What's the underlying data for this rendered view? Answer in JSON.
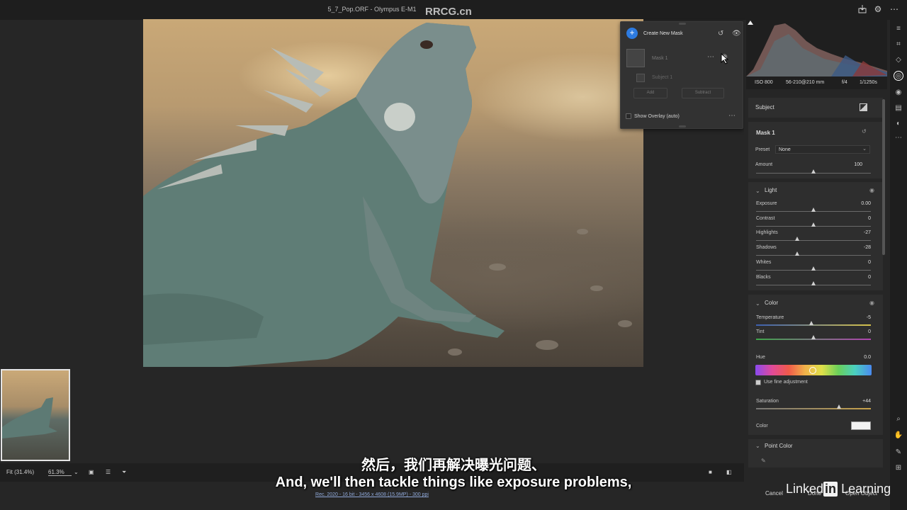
{
  "window": {
    "title": "5_7_Pop.ORF  -  Olympus E-M1"
  },
  "watermark_top": "RRCG.cn",
  "mask_panel": {
    "create_label": "Create New Mask",
    "mask_name": "Mask 1",
    "subject_name": "Subject 1",
    "add_label": "Add",
    "subtract_label": "Subtract",
    "overlay_label": "Show Overlay (auto)"
  },
  "exif": {
    "iso": "ISO 800",
    "lens": "56-210@210 mm",
    "aperture": "f/4",
    "shutter": "1/1250s"
  },
  "subject_header": "Subject",
  "mask": {
    "title": "Mask 1",
    "preset_label": "Preset",
    "preset_value": "None",
    "amount_label": "Amount",
    "amount_value": "100"
  },
  "light": {
    "title": "Light",
    "sliders": [
      {
        "label": "Exposure",
        "value": "0.00",
        "pos": 0.5
      },
      {
        "label": "Contrast",
        "value": "0",
        "pos": 0.5
      },
      {
        "label": "Highlights",
        "value": "-27",
        "pos": 0.36
      },
      {
        "label": "Shadows",
        "value": "-28",
        "pos": 0.36
      },
      {
        "label": "Whites",
        "value": "0",
        "pos": 0.5
      },
      {
        "label": "Blacks",
        "value": "0",
        "pos": 0.5
      }
    ]
  },
  "color_sec": {
    "title": "Color",
    "temperature_label": "Temperature",
    "temperature_value": "-5",
    "temperature_pos": 0.48,
    "tint_label": "Tint",
    "tint_value": "0",
    "tint_pos": 0.5,
    "hue_label": "Hue",
    "hue_value": "0.0",
    "fine_label": "Use fine adjustment",
    "saturation_label": "Saturation",
    "saturation_value": "+44",
    "saturation_pos": 0.72,
    "color_label": "Color"
  },
  "point_color": {
    "title": "Point Color"
  },
  "bottom": {
    "fit_label": "Fit (31.4%)",
    "zoom_label": "61.3%",
    "info": "Rec. 2020 - 16 bit - 3456 x 4608 (15.9MP) - 300 ppi"
  },
  "footer": {
    "cancel": "Cancel",
    "done": "Done",
    "open_object": "Open Object"
  },
  "subtitles": {
    "cn": "然后，我们再解决曝光问题、",
    "en": "And, we'll then tackle things like exposure problems,"
  },
  "linkedin": {
    "word1": "Linked",
    "badge": "in",
    "word2": "Learning"
  },
  "colors": {
    "accent": "#2d7be0",
    "panel": "#2e2e2e",
    "background": "#262626"
  }
}
